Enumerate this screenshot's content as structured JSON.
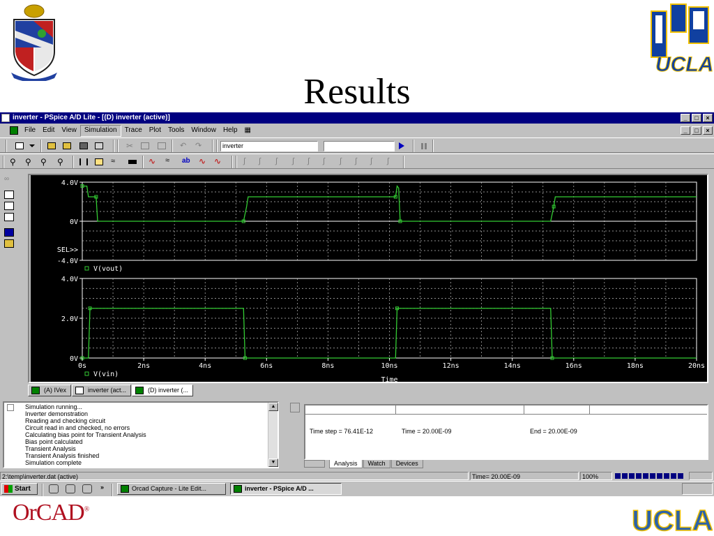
{
  "slide": {
    "title": "Results",
    "footer_logo": "OrCAD",
    "footer_logo_mark": "®",
    "ucla_logo": "UCLA"
  },
  "window": {
    "title": "inverter - PSpice A/D Lite - [(D) inverter (active)]",
    "buttons": {
      "minimize": "_",
      "maximize": "□",
      "close": "×"
    }
  },
  "menu": {
    "items": [
      "File",
      "Edit",
      "View",
      "Simulation",
      "Trace",
      "Plot",
      "Tools",
      "Window",
      "Help"
    ],
    "active_index": 3
  },
  "toolbar": {
    "profile_value": "inverter",
    "second_value": ""
  },
  "plot": {
    "axis_labels": {
      "top_plot_y": [
        "4.0V",
        "0V",
        "-4.0V"
      ],
      "bottom_plot_y": [
        "4.0V",
        "2.0V",
        "0V"
      ],
      "x_ticks": [
        "0s",
        "2ns",
        "4ns",
        "6ns",
        "8ns",
        "10ns",
        "12ns",
        "14ns",
        "16ns",
        "18ns",
        "20ns"
      ],
      "xlabel": "Time"
    },
    "sel_marker": "SEL>>",
    "legend_top": "V(vout)",
    "legend_bottom": "V(vin)",
    "trace_color": "#33cc33",
    "grid_color": "#c0c0c0"
  },
  "chart_data": [
    {
      "type": "line",
      "title": "",
      "xlabel": "Time",
      "ylabel": "",
      "x_unit": "ns",
      "xlim": [
        0,
        20
      ],
      "ylim": [
        -4,
        4
      ],
      "series": [
        {
          "name": "V(vout)",
          "x": [
            0,
            0.15,
            0.2,
            0.45,
            0.5,
            5.2,
            5.25,
            5.35,
            5.4,
            10.2,
            10.25,
            10.3,
            10.35,
            15.2,
            15.25,
            15.35,
            15.4,
            20
          ],
          "y": [
            3.6,
            3.6,
            2.5,
            2.5,
            0,
            0,
            0,
            1.5,
            2.5,
            2.5,
            3.6,
            3.4,
            0,
            0,
            0,
            1.5,
            2.5,
            2.5
          ]
        }
      ]
    },
    {
      "type": "line",
      "title": "",
      "xlabel": "Time",
      "ylabel": "",
      "x_unit": "ns",
      "xlim": [
        0,
        20
      ],
      "ylim": [
        0,
        4
      ],
      "series": [
        {
          "name": "V(vin)",
          "x": [
            0,
            0.2,
            0.25,
            5.25,
            5.3,
            10.2,
            10.25,
            15.25,
            15.3,
            20
          ],
          "y": [
            0,
            0,
            2.5,
            2.5,
            0,
            0,
            2.5,
            2.5,
            0,
            0
          ]
        }
      ]
    }
  ],
  "doc_tabs": [
    "(A) IVex",
    "inverter (act...",
    "(D) inverter (..."
  ],
  "output": {
    "lines": [
      "Simulation running...",
      "Inverter demonstration",
      "Reading and checking circuit",
      "Circuit read in and checked, no errors",
      "Calculating bias point for Transient Analysis",
      "Bias point calculated",
      "Transient Analysis",
      "Transient Analysis finished",
      "Simulation complete"
    ]
  },
  "sim_status": {
    "time_step": "Time step = 76.41E-12",
    "time": "Time = 20.00E-09",
    "end": "End = 20.00E-09",
    "tabs": [
      "Analysis",
      "Watch",
      "Devices"
    ]
  },
  "statusbar": {
    "path": "2:\\temp\\inverter.dat (active)",
    "time": "Time= 20.00E-09",
    "percent": "100%"
  },
  "taskbar": {
    "start": "Start",
    "chevron": "»",
    "buttons": [
      "Orcad Capture - Lite Edit...",
      "inverter - PSpice A/D ..."
    ]
  }
}
